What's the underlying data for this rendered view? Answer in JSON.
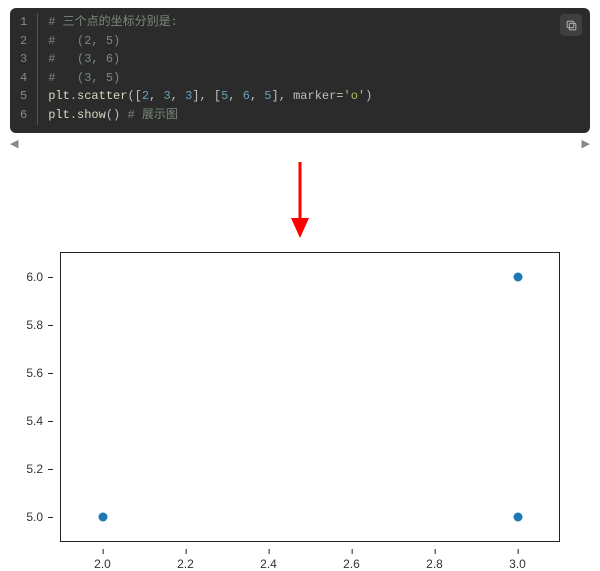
{
  "code": {
    "lines": [
      {
        "n": "1",
        "tokens": [
          {
            "t": "# 三个点的坐标分别是:",
            "c": "tok-comment"
          }
        ]
      },
      {
        "n": "2",
        "tokens": [
          {
            "t": "#   (2, 5)",
            "c": "tok-comment"
          }
        ]
      },
      {
        "n": "3",
        "tokens": [
          {
            "t": "#   (3, 6)",
            "c": "tok-comment"
          }
        ]
      },
      {
        "n": "4",
        "tokens": [
          {
            "t": "#   (3, 5)",
            "c": "tok-comment"
          }
        ]
      },
      {
        "n": "5",
        "tokens": [
          {
            "t": "plt",
            "c": "tok-fn"
          },
          {
            "t": ".",
            "c": "tok-punct"
          },
          {
            "t": "scatter",
            "c": "tok-fn"
          },
          {
            "t": "([",
            "c": "tok-punct"
          },
          {
            "t": "2",
            "c": "tok-num"
          },
          {
            "t": ", ",
            "c": "tok-punct"
          },
          {
            "t": "3",
            "c": "tok-num"
          },
          {
            "t": ", ",
            "c": "tok-punct"
          },
          {
            "t": "3",
            "c": "tok-num"
          },
          {
            "t": "], [",
            "c": "tok-punct"
          },
          {
            "t": "5",
            "c": "tok-num"
          },
          {
            "t": ", ",
            "c": "tok-punct"
          },
          {
            "t": "6",
            "c": "tok-num"
          },
          {
            "t": ", ",
            "c": "tok-punct"
          },
          {
            "t": "5",
            "c": "tok-num"
          },
          {
            "t": "], marker=",
            "c": "tok-punct"
          },
          {
            "t": "'o'",
            "c": "tok-str"
          },
          {
            "t": ")",
            "c": "tok-punct"
          }
        ]
      },
      {
        "n": "6",
        "tokens": [
          {
            "t": "plt",
            "c": "tok-fn"
          },
          {
            "t": ".",
            "c": "tok-punct"
          },
          {
            "t": "show",
            "c": "tok-fn"
          },
          {
            "t": "() ",
            "c": "tok-punct"
          },
          {
            "t": "# 展示图",
            "c": "tok-comment"
          }
        ]
      }
    ],
    "scroll_left": "◀",
    "scroll_right": "▶"
  },
  "arrow_color": "#ff0000",
  "chart_data": {
    "type": "scatter",
    "x": [
      2,
      3,
      3
    ],
    "y": [
      5,
      6,
      5
    ],
    "xlim": [
      1.9,
      3.1
    ],
    "ylim": [
      4.9,
      6.1
    ],
    "xticks": [
      2.0,
      2.2,
      2.4,
      2.6,
      2.8,
      3.0
    ],
    "yticks": [
      5.0,
      5.2,
      5.4,
      5.6,
      5.8,
      6.0
    ],
    "xlabel": "",
    "ylabel": "",
    "title": "",
    "point_color": "#1f77b4"
  }
}
